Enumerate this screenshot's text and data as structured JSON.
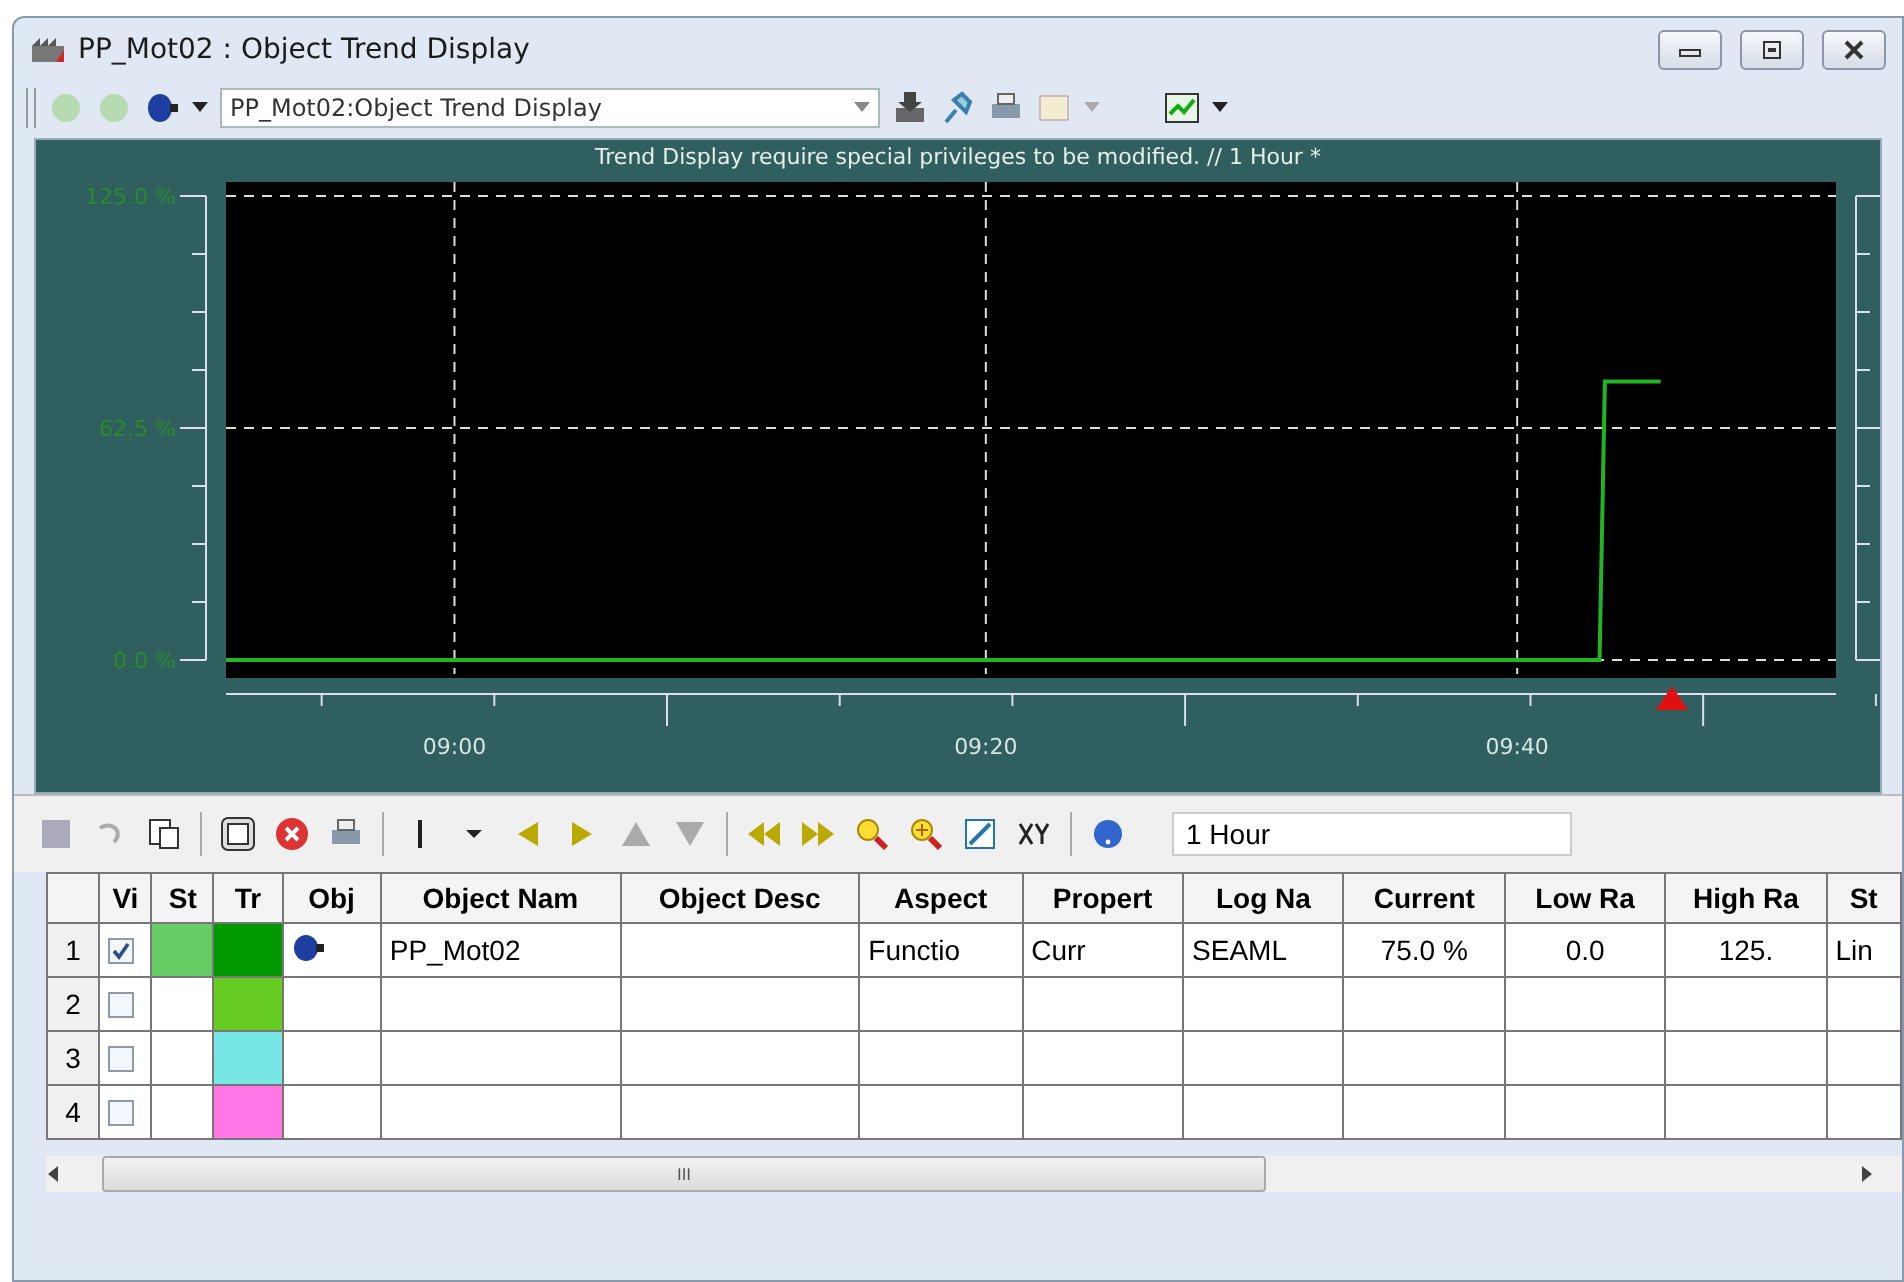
{
  "window": {
    "title": "PP_Mot02 : Object Trend Display"
  },
  "toolbar": {
    "display_select": "PP_Mot02:Object Trend Display"
  },
  "trend": {
    "message": "Trend Display require special privileges to be modified. // 1 Hour *",
    "chart_data": {
      "type": "line",
      "grid": true,
      "x": [
        531.4,
        583.1,
        583.3,
        585.4
      ],
      "series": [
        {
          "color": "#22b422",
          "values": [
            0,
            0,
            75,
            75
          ]
        }
      ],
      "xlim": [
        531.4,
        592
      ],
      "ylim": [
        0,
        125
      ],
      "xticks": [
        {
          "value": 540,
          "label": "09:00"
        },
        {
          "value": 560,
          "label": "09:20"
        },
        {
          "value": 580,
          "label": "09:40"
        }
      ],
      "yticks": [
        {
          "value": 0,
          "label": "0.0 %"
        },
        {
          "value": 62.5,
          "label": "62.5 %"
        },
        {
          "value": 125,
          "label": "125.0 %"
        }
      ]
    }
  },
  "time_range": "1 Hour",
  "table": {
    "columns": [
      "",
      "Vi",
      "St",
      "Tr",
      "Obj",
      "Object Nam",
      "Object Desc",
      "Aspect",
      "Propert",
      "Log Na",
      "Current",
      "Low Ra",
      "High Ra",
      "St"
    ],
    "rows": [
      {
        "checked": true,
        "status": {
          "color": "#66cc66"
        },
        "color": "#009900",
        "object_icon": true,
        "cells": [
          "1",
          "",
          "",
          "",
          "",
          "PP_Mot02",
          "",
          "Functio",
          "Curr",
          "SEAML",
          "75.0 %",
          "0.0",
          "125.",
          "Lin"
        ]
      },
      {
        "checked": false,
        "color": "#66cc22",
        "object_icon": false,
        "cells": [
          "2",
          "",
          "",
          "",
          "",
          "",
          "",
          "",
          "",
          "",
          "",
          "",
          "",
          ""
        ]
      },
      {
        "checked": false,
        "color": "#77e6e6",
        "object_icon": false,
        "cells": [
          "3",
          "",
          "",
          "",
          "",
          "",
          "",
          "",
          "",
          "",
          "",
          "",
          "",
          ""
        ]
      },
      {
        "checked": false,
        "color": "#ff77e6",
        "object_icon": false,
        "cells": [
          "4",
          "",
          "",
          "",
          "",
          "",
          "",
          "",
          "",
          "",
          "",
          "",
          "",
          ""
        ]
      }
    ]
  },
  "scrollbar": {
    "thumb_mark": "III"
  }
}
